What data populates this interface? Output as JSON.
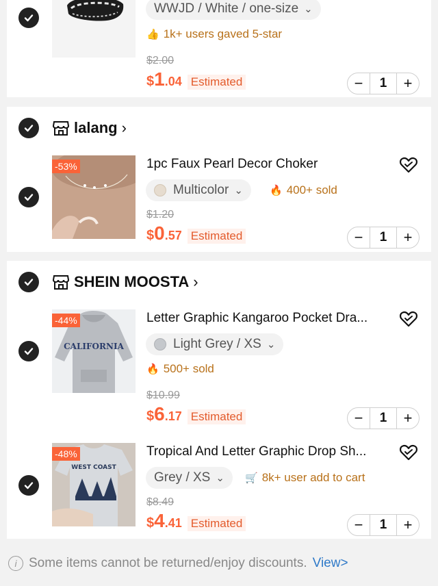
{
  "items": [
    {
      "variant": "WWJD / White / one-size",
      "badge_text": "1k+ users gaved 5-star",
      "original_price": "$2.00",
      "price_currency": "$",
      "price_int": "1",
      "price_dec": ".04",
      "estimated_label": "Estimated",
      "quantity": "1"
    },
    {
      "store": "lalang",
      "discount": "-53%",
      "title": "1pc Faux Pearl Decor Choker",
      "variant": "Multicolor",
      "badge_text": "400+ sold",
      "original_price": "$1.20",
      "price_currency": "$",
      "price_int": "0",
      "price_dec": ".57",
      "estimated_label": "Estimated",
      "quantity": "1"
    },
    {
      "store": "SHEIN MOOSTA",
      "discount": "-44%",
      "title": "Letter Graphic Kangaroo Pocket Dra...",
      "variant": "Light Grey / XS",
      "badge_text": "500+ sold",
      "original_price": "$10.99",
      "price_currency": "$",
      "price_int": "6",
      "price_dec": ".17",
      "estimated_label": "Estimated",
      "quantity": "1",
      "image_text": "CALIFORNIA"
    },
    {
      "discount": "-48%",
      "title": "Tropical And Letter Graphic Drop Sh...",
      "variant": "Grey / XS",
      "badge_text": "8k+ user add to cart",
      "original_price": "$8.49",
      "price_currency": "$",
      "price_int": "4",
      "price_dec": ".41",
      "estimated_label": "Estimated",
      "quantity": "1",
      "image_text": "WEST COAST"
    }
  ],
  "footer": {
    "notice": "Some items cannot be returned/enjoy discounts.",
    "link": "View>"
  },
  "colors": {
    "accent": "#fa6338",
    "badge": "#b8711a",
    "link": "#2e79c8"
  }
}
